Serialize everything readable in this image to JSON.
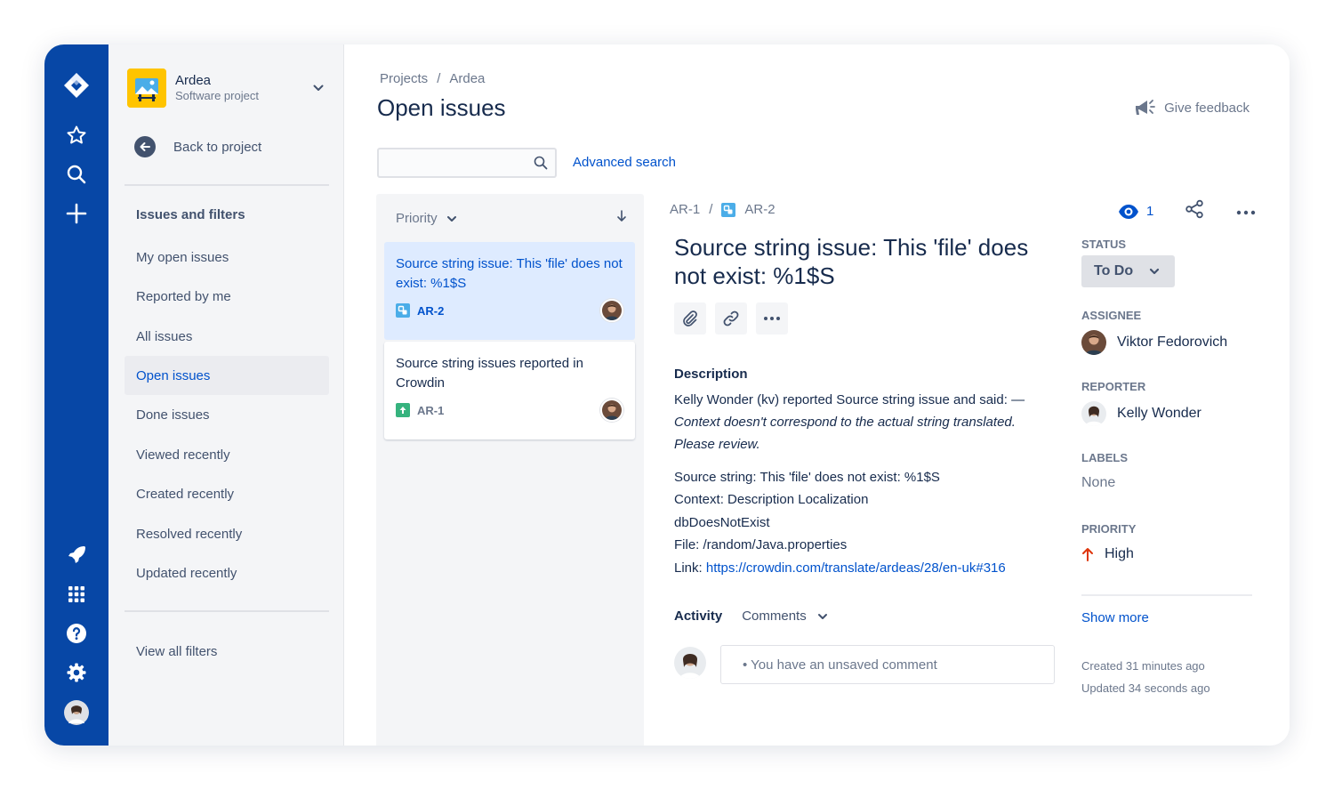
{
  "sidebar": {
    "project_name": "Ardea",
    "project_type": "Software project",
    "back_label": "Back to project",
    "section_title": "Issues and filters",
    "items": [
      {
        "label": "My open issues"
      },
      {
        "label": "Reported by me"
      },
      {
        "label": "All issues"
      },
      {
        "label": "Open issues",
        "active": true
      },
      {
        "label": "Done issues"
      },
      {
        "label": "Viewed recently"
      },
      {
        "label": "Created recently"
      },
      {
        "label": "Resolved recently"
      },
      {
        "label": "Updated recently"
      }
    ],
    "view_all_filters": "View all filters"
  },
  "header": {
    "breadcrumb": [
      "Projects",
      "Ardea"
    ],
    "title": "Open issues",
    "give_feedback": "Give feedback"
  },
  "search": {
    "value": "",
    "advanced_search": "Advanced search"
  },
  "issue_list": {
    "sort_label": "Priority",
    "issues": [
      {
        "title": "Source string issue: This 'file' does not exist: %1$S",
        "key": "AR-2",
        "type_icon": "subtask-icon",
        "selected": true
      },
      {
        "title": "Source string issues reported in Crowdin",
        "key": "AR-1",
        "type_icon": "story-icon",
        "selected": false
      }
    ]
  },
  "issue": {
    "parent_key": "AR-1",
    "key": "AR-2",
    "title": "Source string issue: This 'file' does not exist: %1$S",
    "description_title": "Description",
    "description_intro": "Kelly Wonder (kv) reported Source string issue and said: —",
    "description_italic": "Context doesn't correspond to the actual string translated. Please review.",
    "source_string": "Source string: This 'file' does not exist: %1$S",
    "context": "Context:  Description Localization",
    "context_key": "dbDoesNotExist",
    "file": "File: /random/Java.properties",
    "link_label": "Link: ",
    "link_url": "https://crowdin.com/translate/ardeas/28/en-uk#316",
    "activity_label": "Activity",
    "activity_filter": "Comments",
    "comment_placeholder": "• You have an unsaved comment",
    "watchers": "1",
    "status_label": "STATUS",
    "status": "To Do",
    "assignee_label": "ASSIGNEE",
    "assignee": "Viktor Fedorovich",
    "reporter_label": "REPORTER",
    "reporter": "Kelly Wonder",
    "labels_label": "LABELS",
    "labels": "None",
    "priority_label": "PRIORITY",
    "priority": "High",
    "show_more": "Show more",
    "created": "Created 31 minutes ago",
    "updated": "Updated 34 seconds ago"
  },
  "colors": {
    "nav": "#0747a6",
    "accent": "#0052cc",
    "priority_high": "#de350b",
    "story": "#36b37e",
    "subtask": "#4bade8"
  }
}
